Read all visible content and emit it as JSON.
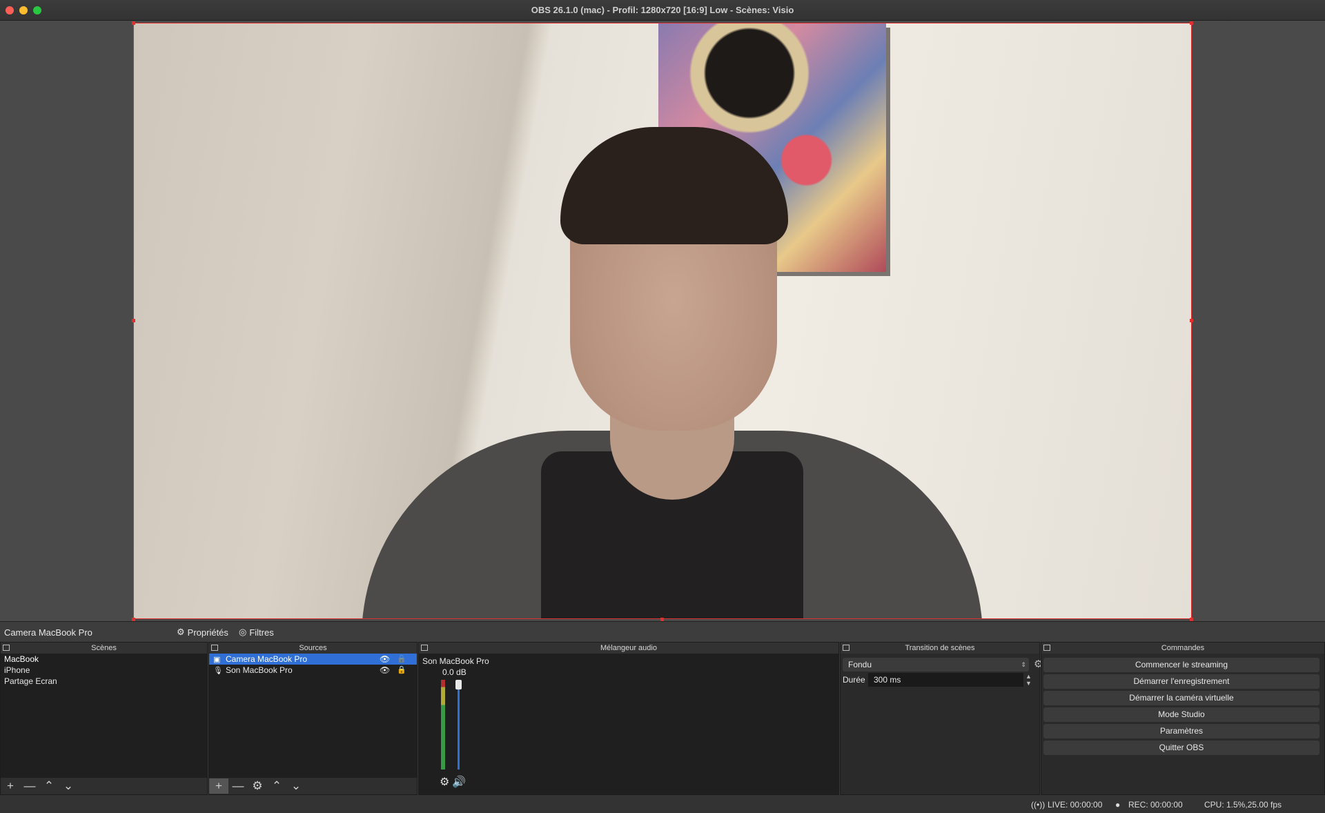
{
  "window": {
    "title": "OBS 26.1.0 (mac) - Profil: 1280x720 [16:9] Low - Scènes: Visio"
  },
  "context_bar": {
    "source_name": "Camera MacBook Pro",
    "properties_label": "Propriétés",
    "filters_label": "Filtres"
  },
  "scenes": {
    "header": "Scènes",
    "items": [
      {
        "label": "MacBook"
      },
      {
        "label": "iPhone"
      },
      {
        "label": "Partage Ecran"
      }
    ]
  },
  "sources": {
    "header": "Sources",
    "items": [
      {
        "label": "Camera MacBook Pro",
        "icon": "camera-icon"
      },
      {
        "label": "Son MacBook Pro",
        "icon": "microphone-icon"
      }
    ]
  },
  "mixer": {
    "header": "Mélangeur audio",
    "channel_name": "Son MacBook Pro",
    "level": "0.0 dB"
  },
  "transitions": {
    "header": "Transition de scènes",
    "selected": "Fondu",
    "duration_label": "Durée",
    "duration_value": "300 ms"
  },
  "commands": {
    "header": "Commandes",
    "buttons": [
      "Commencer le streaming",
      "Démarrer l'enregistrement",
      "Démarrer la caméra virtuelle",
      "Mode Studio",
      "Paramètres",
      "Quitter OBS"
    ]
  },
  "status": {
    "live": "LIVE: 00:00:00",
    "rec": "REC: 00:00:00",
    "cpu": "CPU: 1.5%,25.00 fps"
  },
  "colors": {
    "accent": "#2f6fd6",
    "preview_border": "#e03030",
    "background": "#3a3a3a"
  }
}
